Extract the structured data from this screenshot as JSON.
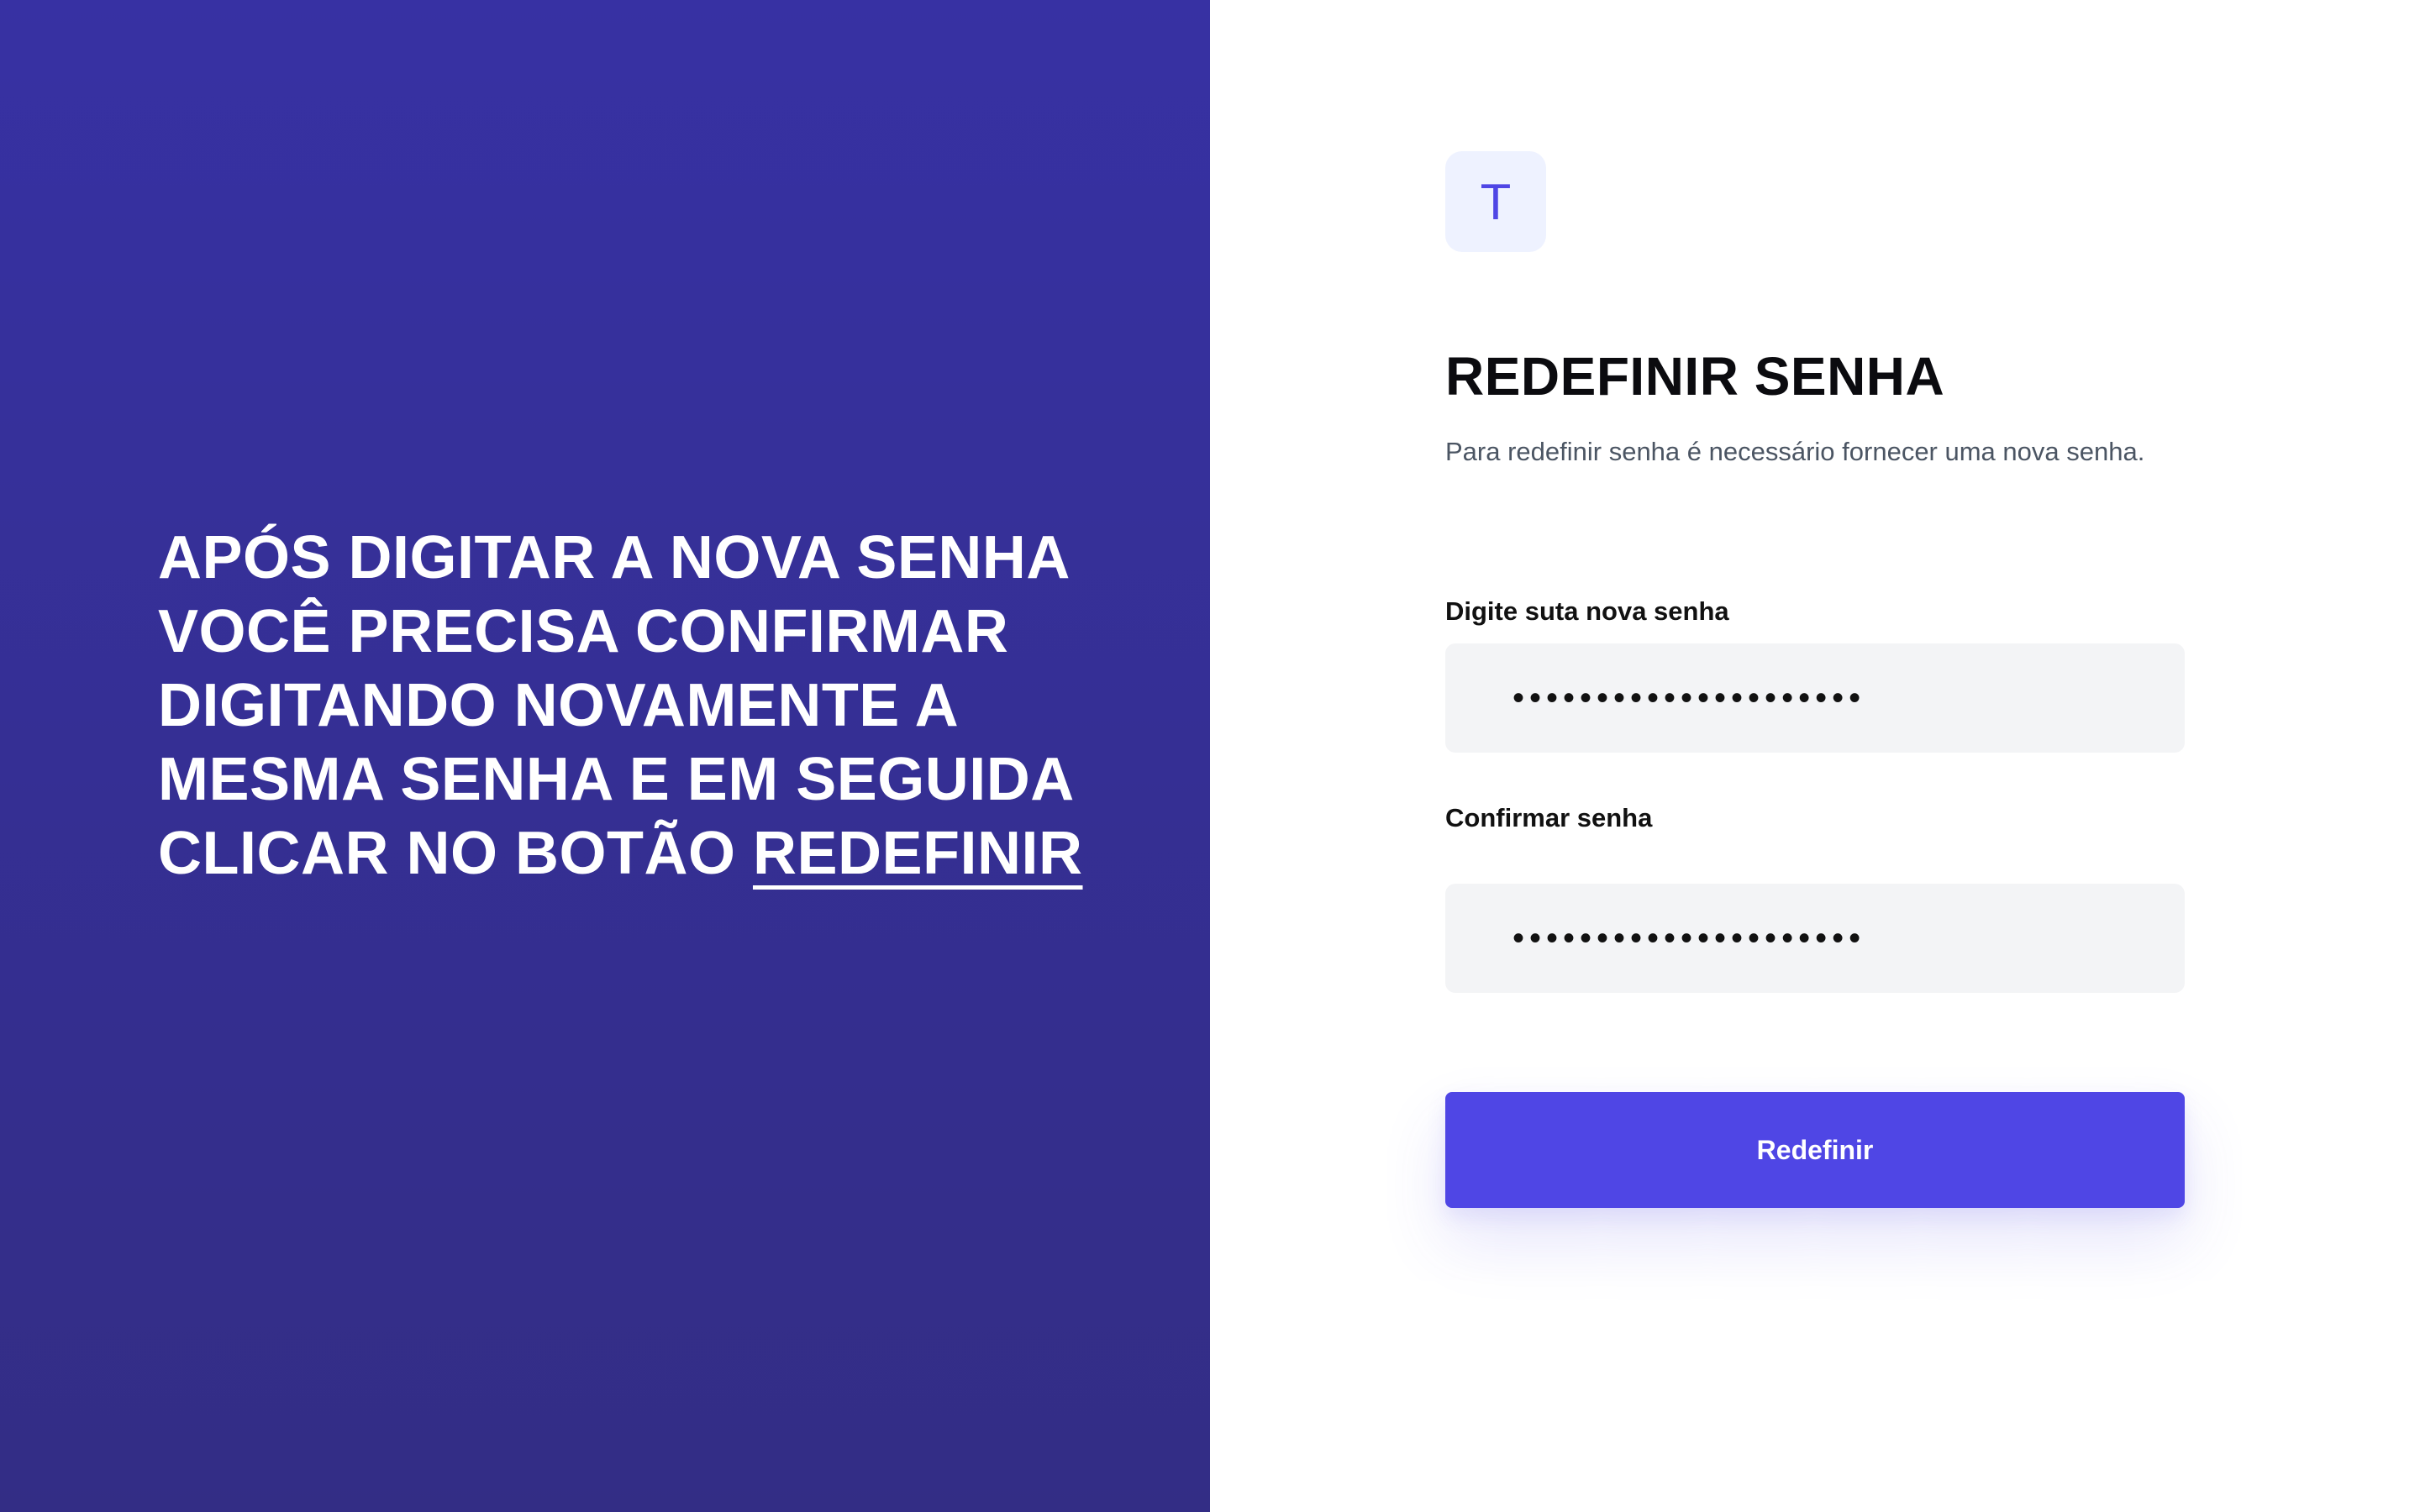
{
  "left_panel": {
    "message_lines": [
      "APÓS DIGITAR A NOVA SENHA",
      "VOCÊ PRECISA CONFIRMAR",
      "DIGITANDO NOVAMENTE A",
      "MESMA SENHA E EM SEGUIDA",
      "CLICAR NO BOTÃO "
    ],
    "message_highlight": "REDEFINIR"
  },
  "form": {
    "logo_letter": "T",
    "title": "REDEFINIR SENHA",
    "subtitle": "Para redefinir senha é necessário fornecer uma nova senha.",
    "new_password": {
      "label": "Digite suta nova senha",
      "value": "•••••••••••••••••••••"
    },
    "confirm_password": {
      "label": "Confirmar senha",
      "value": "•••••••••••••••••••••"
    },
    "submit_label": "Redefinir"
  },
  "colors": {
    "panel_gradient_top": "#3731a3",
    "panel_gradient_bottom": "#332d85",
    "accent": "#4f46e5",
    "logo_background": "#eef2ff",
    "input_background": "#f3f4f6"
  }
}
